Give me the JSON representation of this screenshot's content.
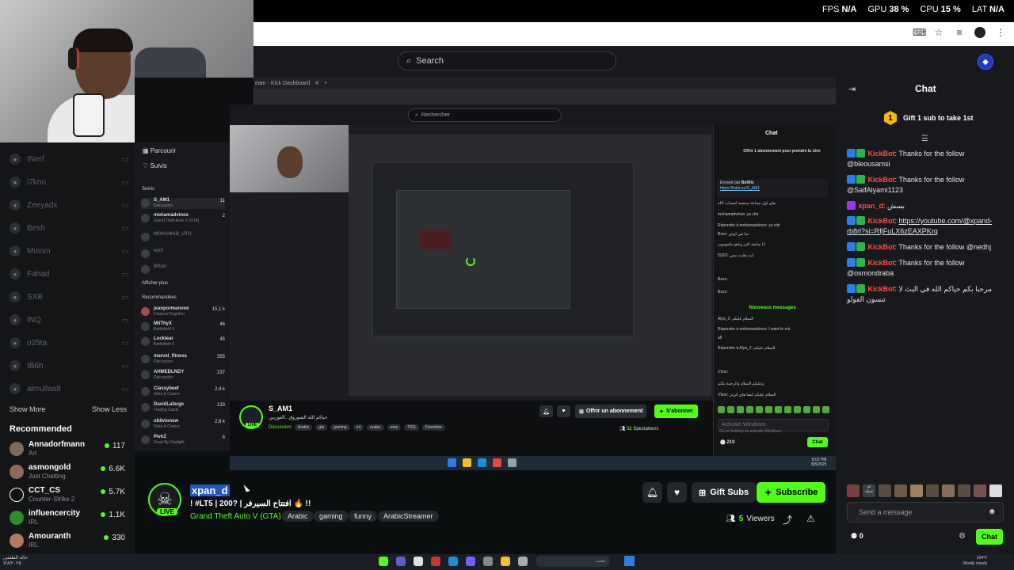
{
  "perf": {
    "fps_label": "FPS",
    "fps_value": "N/A",
    "gpu_label": "GPU",
    "gpu_value": "38 %",
    "cpu_label": "CPU",
    "cpu_value": "15 %",
    "lat_label": "LAT",
    "lat_value": "N/A"
  },
  "header": {
    "search_placeholder": "Search"
  },
  "sidebar": {
    "followed": [
      {
        "name": "INerf"
      },
      {
        "name": "i7kno"
      },
      {
        "name": "Zeeyadx"
      },
      {
        "name": "Besh"
      },
      {
        "name": "Muvxn"
      },
      {
        "name": "Fahad"
      },
      {
        "name": "SXB"
      },
      {
        "name": "INQ"
      },
      {
        "name": "o25ta"
      },
      {
        "name": "IB6h"
      },
      {
        "name": "almullaa8"
      }
    ],
    "show_more": "Show More",
    "show_less": "Show Less",
    "recommended_title": "Recommended",
    "recommended": [
      {
        "name": "Annadorfmann",
        "category": "Art",
        "viewers": "117"
      },
      {
        "name": "asmongold",
        "category": "Just Chatting",
        "viewers": "6.6K"
      },
      {
        "name": "CCT_CS",
        "category": "Counter-Strike 2",
        "viewers": "5.7K"
      },
      {
        "name": "influencercity",
        "category": "IRL",
        "viewers": "1.1K"
      },
      {
        "name": "Amouranth",
        "category": "IRL",
        "viewers": "330"
      }
    ]
  },
  "inner": {
    "tab_title": "eam - Kick Dashboard",
    "search_placeholder": "Rechercher",
    "nav1": "Parcourir",
    "nav2": "Suivis",
    "suivis_label": "Suivis",
    "followed": [
      {
        "name": "S_AM1",
        "category": "Discussion",
        "viewers": "11"
      },
      {
        "name": "mohamadvinox",
        "category": "Grand Theft Auto V (GTA)",
        "viewers": "2"
      },
      {
        "name": "MOHAMAD_UTU",
        "category": "",
        "viewers": ""
      },
      {
        "name": "wolf",
        "category": "",
        "viewers": ""
      },
      {
        "name": "BRati",
        "category": "",
        "viewers": ""
      }
    ],
    "afficher_plus": "Afficher plus",
    "recommandees": "Recommandées",
    "recommended": [
      {
        "name": "jeanpormanove",
        "category": "Chained Together",
        "viewers": "15,1 k"
      },
      {
        "name": "MiiThyX",
        "category": "Battlefield 6",
        "viewers": "46"
      },
      {
        "name": "Locklear",
        "category": "Battlefield 6",
        "viewers": "45"
      },
      {
        "name": "marvel_fitness",
        "category": "Discussion",
        "viewers": "355"
      },
      {
        "name": "AHMEDLNDY",
        "category": "Discussion",
        "viewers": "237"
      },
      {
        "name": "Classybeef",
        "category": "Slots & Casino",
        "viewers": "2,4 k"
      },
      {
        "name": "DavidLafarge",
        "category": "Trading Cards",
        "viewers": "133"
      },
      {
        "name": "oblivionsw",
        "category": "Slots & Casino",
        "viewers": "2,8 k"
      },
      {
        "name": "PwnZ",
        "category": "Dead By Daylight",
        "viewers": "6"
      }
    ],
    "stream": {
      "name": "S_AM1",
      "live": "LIVE",
      "title": "حياكم الله الشوروق ..العوربين",
      "category": "Discussion",
      "tags": [
        "Arabic",
        "gta",
        "gaming",
        "mt",
        "arabic",
        "ems",
        "TRG",
        "Fivemlive"
      ],
      "gift_label": "Offrir un abonnement",
      "subscribe_label": "S'abonner",
      "viewers_count": "11",
      "viewers_label": "Spectateurs"
    },
    "chat": {
      "title": "Chat",
      "gift_text": "Offrir 1 abonnement pour prendre la 1ère",
      "pinned_by": "Envoyé par",
      "pinned_user": "BotRix",
      "pinned_link": "https://linktr.ee/S_AM1",
      "lines": [
        "هاي اول جماعة سنجمة لحساب الله",
        "mohamadvinox: ya chir",
        "Répondre à mohamadvinox: ya chir",
        "Bozz: حيا هي اوش",
        "انا سايفه كثير وياهو ملحومون",
        "ISDO: انت هليت معي",
        "Bozz: ",
        "Bozz: "
      ],
      "new_messages": "Nouveaux messages",
      "lines2": [
        "Alya_2: السلام عليكم",
        "Répondre à mohamadvinox: I want to out",
        "all",
        "Répondre à Alya_2: السلام عليكم",
        "i7kno: ",
        "وعليكم السلام والرحمة بلكم",
        "i7kno: السلام عليكم ايضا هاي كرينز"
      ],
      "input_placeholder": "Activate Windows",
      "activate_sub": "Go to Settings to activate Windows.",
      "points": "210",
      "chat_button": "Chat"
    },
    "taskbar": {
      "time": "8:02 PM",
      "date": "8/8/2025"
    }
  },
  "stream": {
    "username": "xpan_d",
    "live": "LIVE",
    "title": "! #LT5 | 200? | افتتاح السيرفر 🔥 !!",
    "category": "Grand Theft Auto V (GTA)",
    "tags": [
      "Arabic",
      "gaming",
      "funny",
      "ArabicStreamer"
    ],
    "gift_label": "Gift Subs",
    "subscribe_label": "Subscribe",
    "viewers_count": "5",
    "viewers_label": "Viewers"
  },
  "chat": {
    "title": "Chat",
    "gift_text": "Gift 1 sub to take 1st",
    "gift_badge": "1",
    "messages": [
      {
        "user": "KickBot",
        "text": ": Thanks for the follow @bleousamsi",
        "link": ""
      },
      {
        "user": "KickBot",
        "text": ": Thanks for the follow @SaifAlyami1123",
        "link": ""
      },
      {
        "user": "xpan_d",
        "text": ": بسش",
        "link": ""
      },
      {
        "user": "KickBot",
        "text": ": ",
        "link": "https://youtube.com/@xpand-rb8rl?si=RfjFuLX6zEAXPKrq"
      },
      {
        "user": "KickBot",
        "text": ": Thanks for the follow @nedhj",
        "link": ""
      },
      {
        "user": "KickBot",
        "text": ": Thanks for the follow @osmondraba",
        "link": ""
      },
      {
        "user": "KickBot",
        "text": ": مرحبا بكم حياكم الله في البث لا تنسون الفولو",
        "link": ""
      }
    ],
    "input_placeholder": "Send a message",
    "points": "0",
    "chat_button": "Chat",
    "emote_label": "ام تحبك"
  },
  "taskbar": {
    "left_line1": "حالة الطقس",
    "left_line2": "٧/٨/٢٠٢٥",
    "search_text": "بحث",
    "weather_line1": "104°F",
    "weather_line2": "Mostly cloudy"
  },
  "colors": {
    "kick_green": "#53fc18",
    "kickbot_red": "#ff4d4d",
    "bg": "#0b0e0f"
  }
}
